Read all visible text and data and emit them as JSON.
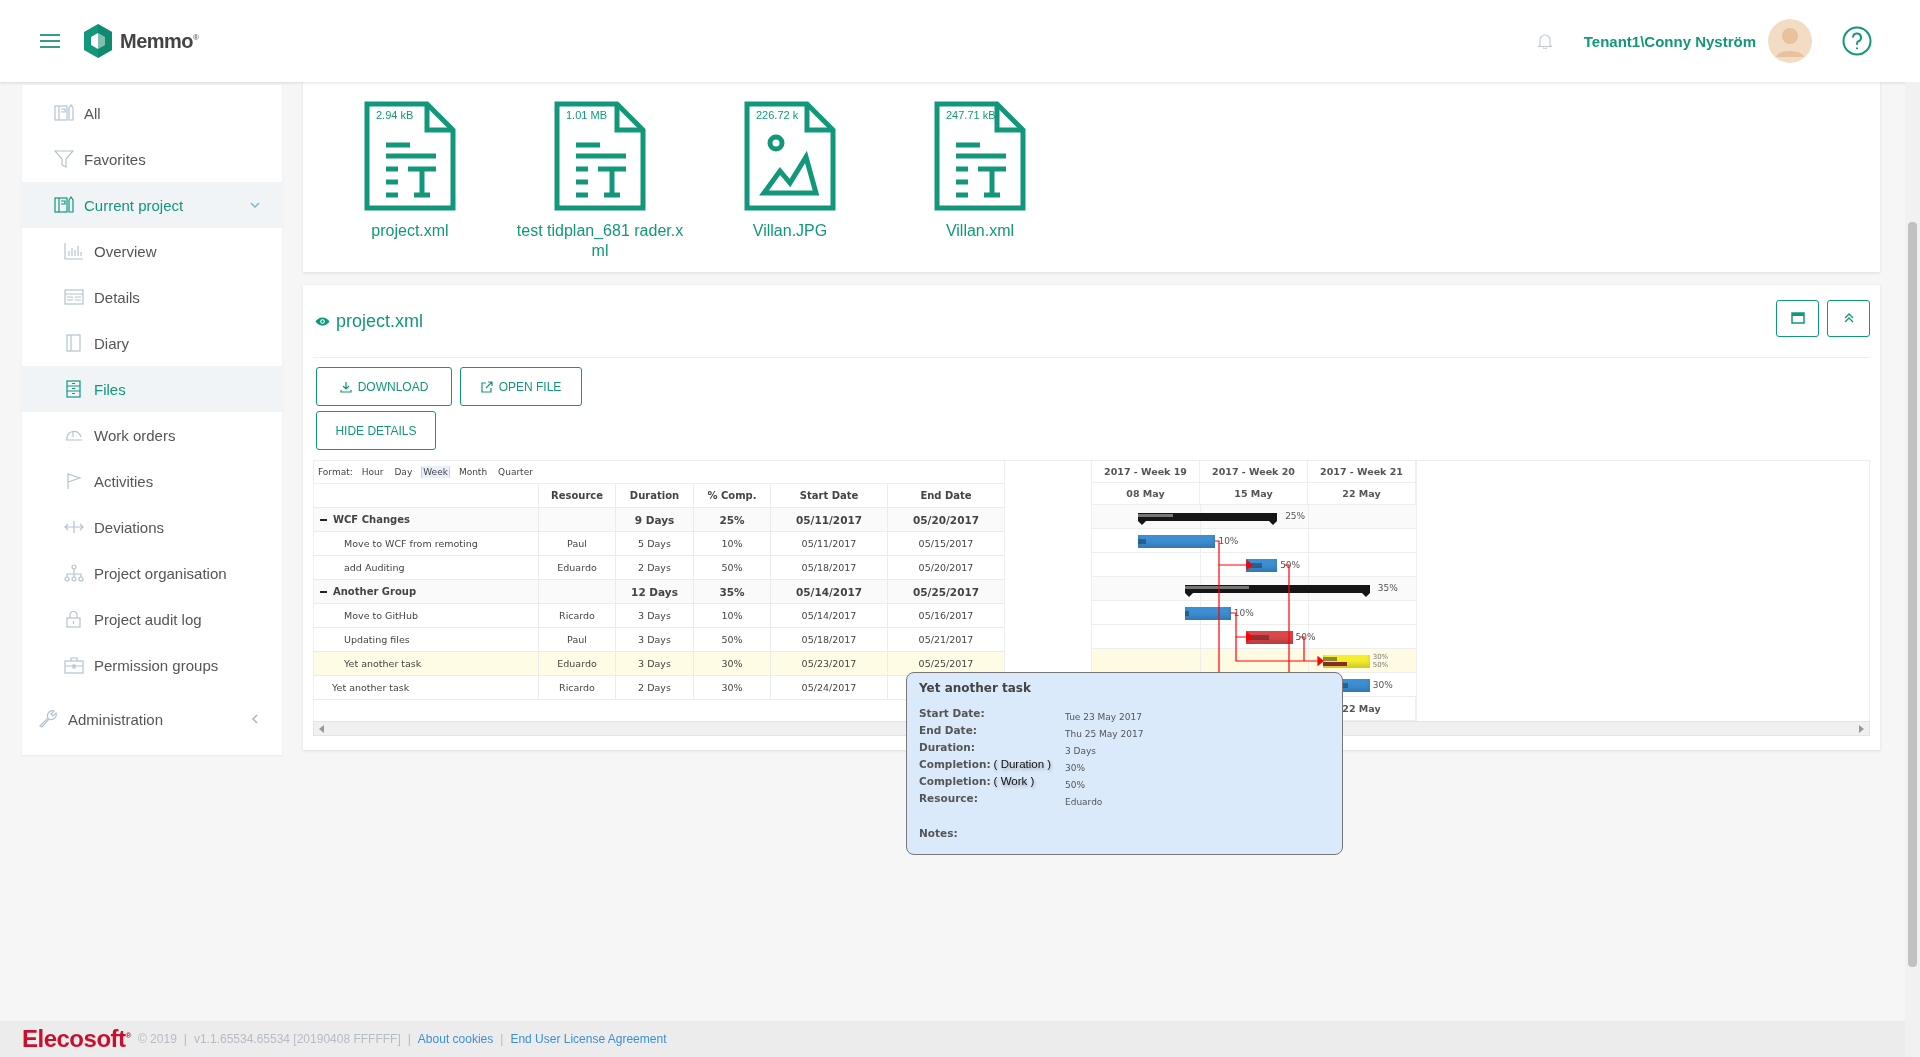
{
  "header": {
    "logo_text": "Memmo",
    "logo_mark": "®",
    "user": "Tenant1\\Conny Nyström"
  },
  "sidebar": {
    "items": [
      {
        "kind": "all",
        "label": "All",
        "selected": false
      },
      {
        "kind": "favorites",
        "label": "Favorites",
        "selected": false
      },
      {
        "kind": "project",
        "label": "Current project",
        "selected": true,
        "expanded": true,
        "children": [
          {
            "kind": "overview",
            "label": "Overview",
            "selected": false
          },
          {
            "kind": "details",
            "label": "Details",
            "selected": false
          },
          {
            "kind": "diary",
            "label": "Diary",
            "selected": false
          },
          {
            "kind": "files",
            "label": "Files",
            "selected": true
          },
          {
            "kind": "workorders",
            "label": "Work orders",
            "selected": false
          },
          {
            "kind": "activities",
            "label": "Activities",
            "selected": false
          },
          {
            "kind": "deviations",
            "label": "Deviations",
            "selected": false
          },
          {
            "kind": "organisation",
            "label": "Project organisation",
            "selected": false
          },
          {
            "kind": "audit",
            "label": "Project audit log",
            "selected": false
          },
          {
            "kind": "permissions",
            "label": "Permission groups",
            "selected": false
          }
        ]
      },
      {
        "kind": "admin",
        "label": "Administration",
        "selected": false,
        "expanded": false
      }
    ]
  },
  "files": [
    {
      "kind": "text",
      "size": "2.94 kB",
      "name": "project.xml"
    },
    {
      "kind": "text",
      "size": "1.01 MB",
      "name": "test tidplan_681 rader.xml"
    },
    {
      "kind": "image",
      "size": "226.72 k",
      "name": "Villan.JPG"
    },
    {
      "kind": "text",
      "size": "247.71 kB",
      "name": "Villan.xml"
    }
  ],
  "preview": {
    "title": "project.xml",
    "buttons": [
      {
        "kind": "download",
        "label": "DOWNLOAD"
      },
      {
        "kind": "open",
        "label": "OPEN FILE"
      },
      {
        "kind": "details",
        "label": "HIDE DETAILS"
      }
    ]
  },
  "gantt": {
    "format_label": "Format:",
    "formats": [
      {
        "label": "Hour",
        "selected": false
      },
      {
        "label": "Day",
        "selected": false
      },
      {
        "label": "Week",
        "selected": true
      },
      {
        "label": "Month",
        "selected": false
      },
      {
        "label": "Quarter",
        "selected": false
      }
    ],
    "columns": [
      "Resource",
      "Duration",
      "% Comp.",
      "Start Date",
      "End Date"
    ],
    "rows": [
      {
        "kind": "group",
        "name": "WCF Changes",
        "expanded": true,
        "selected": false,
        "duration": "9 Days",
        "complete": "25%",
        "start_date": "05/11/2017",
        "end_date": "05/20/2017",
        "summary_label": "25%",
        "children": [
          {
            "kind": "task",
            "name": "Move to WCF from remoting",
            "resource": "Paul",
            "duration": "5 Days",
            "complete": "10%",
            "start_date": "05/11/2017",
            "end_date": "05/15/2017",
            "selected": false,
            "color": "#3c8fd3",
            "bar_labels": [
              "10%"
            ]
          },
          {
            "kind": "task",
            "name": "add Auditing",
            "resource": "Eduardo",
            "duration": "2 Days",
            "complete": "50%",
            "start_date": "05/18/2017",
            "end_date": "05/20/2017",
            "selected": false,
            "color": "#3c8fd3",
            "bar_labels": [
              "50%"
            ]
          }
        ]
      },
      {
        "kind": "group",
        "name": "Another Group",
        "expanded": true,
        "selected": false,
        "duration": "12 Days",
        "complete": "35%",
        "start_date": "05/14/2017",
        "end_date": "05/25/2017",
        "summary_label": "35%",
        "children": [
          {
            "kind": "task",
            "name": "Move to GitHub",
            "resource": "Ricardo",
            "duration": "3 Days",
            "complete": "10%",
            "start_date": "05/14/2017",
            "end_date": "05/16/2017",
            "selected": false,
            "color": "#3c8fd3",
            "bar_labels": [
              "10%"
            ]
          },
          {
            "kind": "task",
            "name": "Updating files",
            "resource": "Paul",
            "duration": "3 Days",
            "complete": "50%",
            "start_date": "05/18/2017",
            "end_date": "05/21/2017",
            "selected": false,
            "color": "#d9484b",
            "bar_labels": [
              "50%"
            ]
          },
          {
            "kind": "task",
            "name": "Yet another task",
            "resource": "Eduardo",
            "duration": "3 Days",
            "complete": "30%",
            "start_date": "05/23/2017",
            "end_date": "05/25/2017",
            "selected": true,
            "color": "#f4ef2e",
            "bar_labels": [
              "30%",
              "50%"
            ]
          }
        ]
      },
      {
        "kind": "task",
        "name": "Yet another task",
        "resource": "Ricardo",
        "duration": "2 Days",
        "complete": "30%",
        "start_date": "05/24/2017",
        "selected": false,
        "color": "#3c8fd3",
        "bar_labels": [
          "30%"
        ]
      }
    ],
    "chart": {
      "weeks": [
        "2017 - Week 19",
        "2017 - Week 20",
        "2017 - Week 21"
      ],
      "days": [
        "08 May",
        "15 May",
        "22 May"
      ],
      "footer_day": "22 May"
    }
  },
  "tooltip": {
    "title": "Yet another task",
    "fields": [
      {
        "label": "Start Date:",
        "value": "Tue 23 May 2017"
      },
      {
        "label": "End Date:",
        "value": "Thu 25 May 2017"
      },
      {
        "label": "Duration:",
        "value": "3 Days"
      },
      {
        "label": "Completion:",
        "qualifier": "( Duration )",
        "value": "30%"
      },
      {
        "label": "Completion:",
        "qualifier": "( Work )",
        "value": "50%"
      },
      {
        "label": "Resource:",
        "value": "Eduardo"
      }
    ],
    "notes_label": "Notes:"
  },
  "footer": {
    "brand": "Elecosoft",
    "brand_mark": "®",
    "items": [
      {
        "kind": "text",
        "text": "© 2019"
      },
      {
        "kind": "separator",
        "text": "|"
      },
      {
        "kind": "text",
        "text": "v1.1.65534.65534 [20190408 FFFFFF]"
      },
      {
        "kind": "separator",
        "text": "|"
      },
      {
        "kind": "link",
        "text": "About cookies"
      },
      {
        "kind": "separator",
        "text": "|"
      },
      {
        "kind": "link",
        "text": "End User License Agreement"
      }
    ]
  }
}
